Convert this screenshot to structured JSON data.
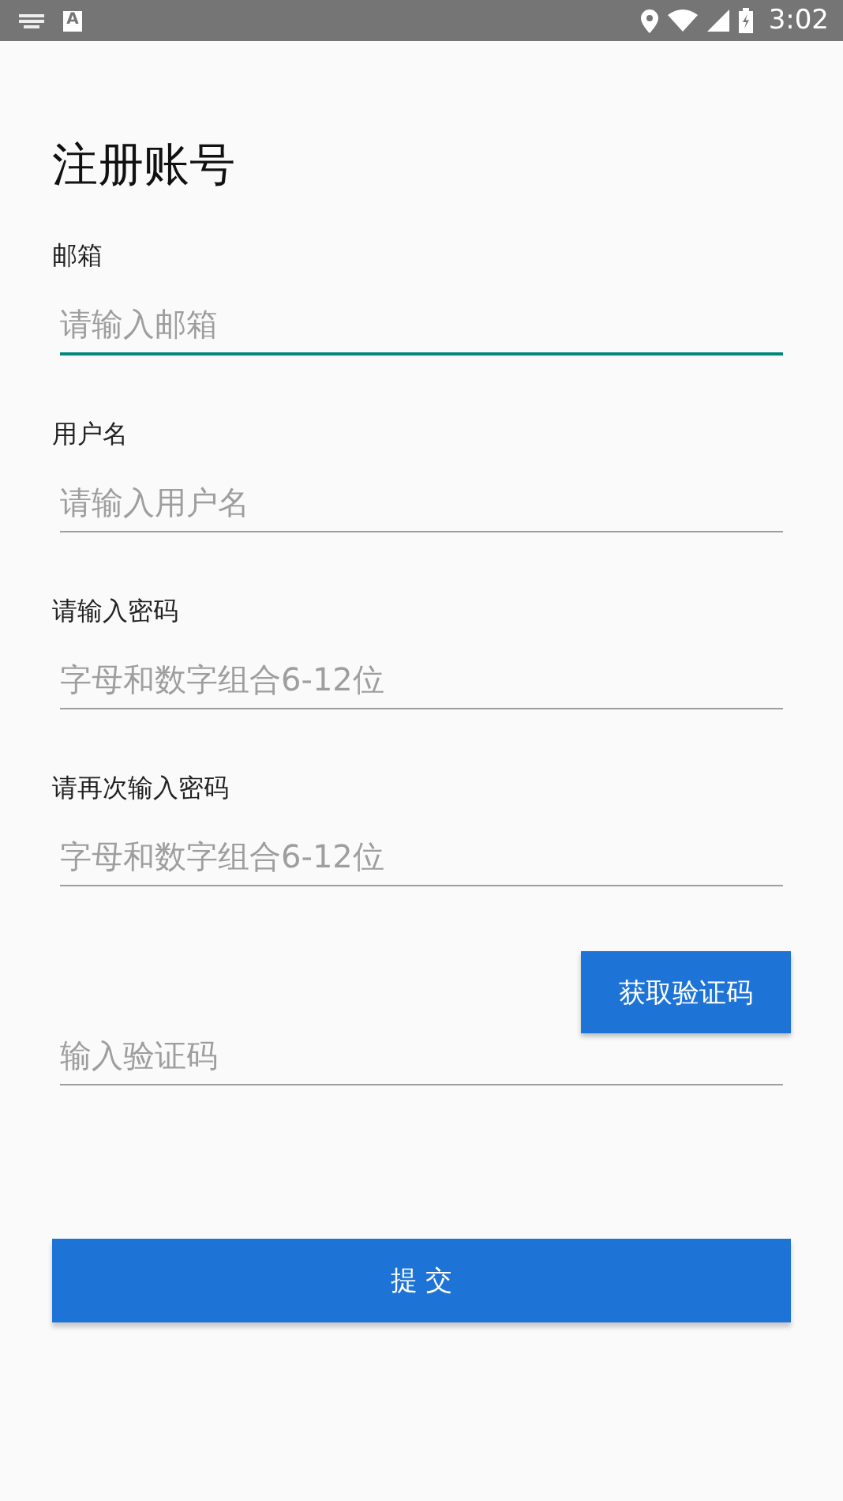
{
  "status_bar": {
    "input_badge": "A",
    "time": "3:02"
  },
  "title": "注册账号",
  "fields": [
    {
      "label": "邮箱",
      "placeholder": "请输入邮箱",
      "focused": true
    },
    {
      "label": "用户名",
      "placeholder": "请输入用户名",
      "focused": false
    },
    {
      "label": "请输入密码",
      "placeholder": "字母和数字组合6-12位",
      "focused": false
    },
    {
      "label": "请再次输入密码",
      "placeholder": "字母和数字组合6-12位",
      "focused": false
    }
  ],
  "code": {
    "placeholder": "输入验证码",
    "focused": false,
    "button": "获取验证码"
  },
  "submit": "提 交"
}
